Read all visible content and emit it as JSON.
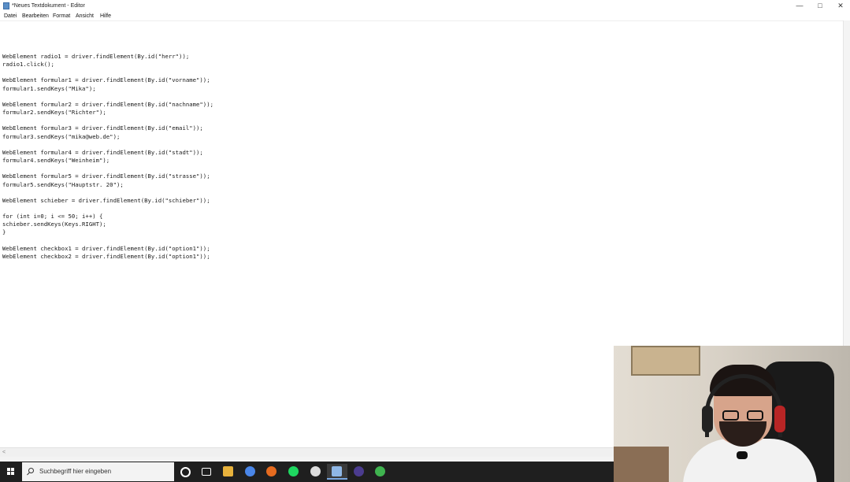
{
  "window": {
    "title": "*Neues Textdokument - Editor",
    "buttons": {
      "minimize": "—",
      "maximize": "□",
      "close": "✕"
    }
  },
  "menu": [
    "Datei",
    "Bearbeiten",
    "Format",
    "Ansicht",
    "Hilfe"
  ],
  "editor": {
    "lines": [
      "WebElement radio1 = driver.findElement(By.id(\"herr\"));",
      "radio1.click();",
      "",
      "WebElement formular1 = driver.findElement(By.id(\"vorname\"));",
      "formular1.sendKeys(\"Mika\");",
      "",
      "WebElement formular2 = driver.findElement(By.id(\"nachname\"));",
      "formular2.sendKeys(\"Richter\");",
      "",
      "WebElement formular3 = driver.findElement(By.id(\"email\"));",
      "formular3.sendKeys(\"mika@web.de\");",
      "",
      "WebElement formular4 = driver.findElement(By.id(\"stadt\"));",
      "formular4.sendKeys(\"Weinheim\");",
      "",
      "WebElement formular5 = driver.findElement(By.id(\"strasse\"));",
      "formular5.sendKeys(\"Hauptstr. 20\");",
      "",
      "WebElement schieber = driver.findElement(By.id(\"schieber\"));",
      "",
      "for (int i=0; i <= 50; i++) {",
      "schieber.sendKeys(Keys.RIGHT);",
      "}",
      "",
      "WebElement checkbox1 = driver.findElement(By.id(\"option1\"));",
      "WebElement checkbox2 = driver.findElement(By.id(\"option1\"));"
    ]
  },
  "scrollbar": {
    "left_arrow": "<"
  },
  "taskbar": {
    "search_placeholder": "Suchbegriff hier eingeben",
    "icons": [
      {
        "name": "cortana-icon",
        "color": "#ffffff"
      },
      {
        "name": "task-view-icon",
        "color": "#ffffff"
      },
      {
        "name": "file-explorer-icon",
        "color": "#e8b23c"
      },
      {
        "name": "chrome-icon",
        "color": "#4a86e8"
      },
      {
        "name": "firefox-icon",
        "color": "#e66b1f"
      },
      {
        "name": "spotify-icon",
        "color": "#1ed760"
      },
      {
        "name": "obs-icon",
        "color": "#dddddd"
      },
      {
        "name": "notepad-icon",
        "color": "#8fb7e6"
      },
      {
        "name": "eclipse-icon",
        "color": "#4b3c8f"
      },
      {
        "name": "app-icon",
        "color": "#3fb34f"
      }
    ]
  }
}
